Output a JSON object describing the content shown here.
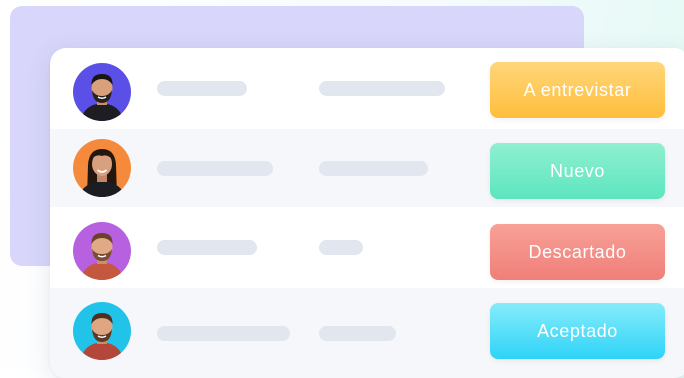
{
  "candidates": [
    {
      "avatar": "man-dark-hair-beard-photo",
      "status_label": "A entrevistar",
      "status_color": "#FFC34A",
      "avatar_bg": "#5A4FE6"
    },
    {
      "avatar": "woman-long-dark-hair-photo",
      "status_label": "Nuevo",
      "status_color": "#5FE6C1",
      "avatar_bg": "#F58A3D"
    },
    {
      "avatar": "man-brown-hair-beard-photo",
      "status_label": "Descartado",
      "status_color": "#F28A80",
      "avatar_bg": "#B760E0"
    },
    {
      "avatar": "man-brown-hair-beard-photo",
      "status_label": "Aceptado",
      "status_color": "#3ED7F8",
      "avatar_bg": "#22C3E8"
    }
  ],
  "colors": {
    "background_card": "#D8D6FB",
    "skeleton": "#E1E6EF",
    "row_shade": "#F6F7FA"
  }
}
